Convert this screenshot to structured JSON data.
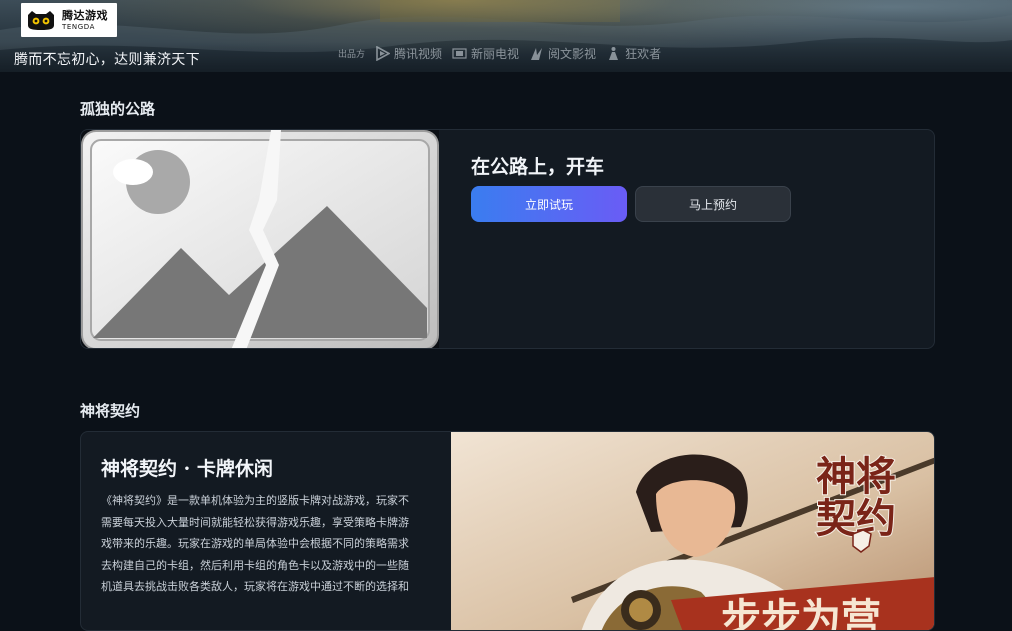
{
  "header": {
    "logo_cn": "腾达游戏",
    "logo_en": "TENGDA",
    "slogan": "腾而不忘初心，达则兼济天下",
    "publisher_label": "出品方",
    "publishers": [
      {
        "name": "腾讯视频",
        "icon": "play-triangle-icon"
      },
      {
        "name": "新丽电视",
        "icon": "newpage-box-icon"
      },
      {
        "name": "阅文影视",
        "icon": "book-leaf-icon"
      },
      {
        "name": "狂欢者",
        "icon": "figure-icon"
      }
    ]
  },
  "sections": [
    {
      "title": "孤独的公路",
      "card_title": "在公路上，开车",
      "primary_button": "立即试玩",
      "secondary_button": "马上预约"
    },
    {
      "title": "神将契约",
      "card_title": "神将契约 · 卡牌休闲",
      "description": "《神将契约》是一款单机体验为主的竖版卡牌对战游戏，玩家不需要每天投入大量时间就能轻松获得游戏乐趣，享受策略卡牌游戏带来的乐趣。玩家在游戏的单局体验中会根据不同的策略需求去构建自己的卡组，然后利用卡组的角色卡以及游戏中的一些随机道具去挑战击败各类敌人，玩家将在游戏中通过不断的选择和",
      "art_title": "神将契约",
      "art_banner": "步步为营"
    }
  ],
  "colors": {
    "page_bg": "#0b1118",
    "card_bg": "#131a22",
    "primary_gradient_start": "#3a7df0",
    "primary_gradient_end": "#6a5cf5",
    "banner_red": "#a8321e"
  }
}
